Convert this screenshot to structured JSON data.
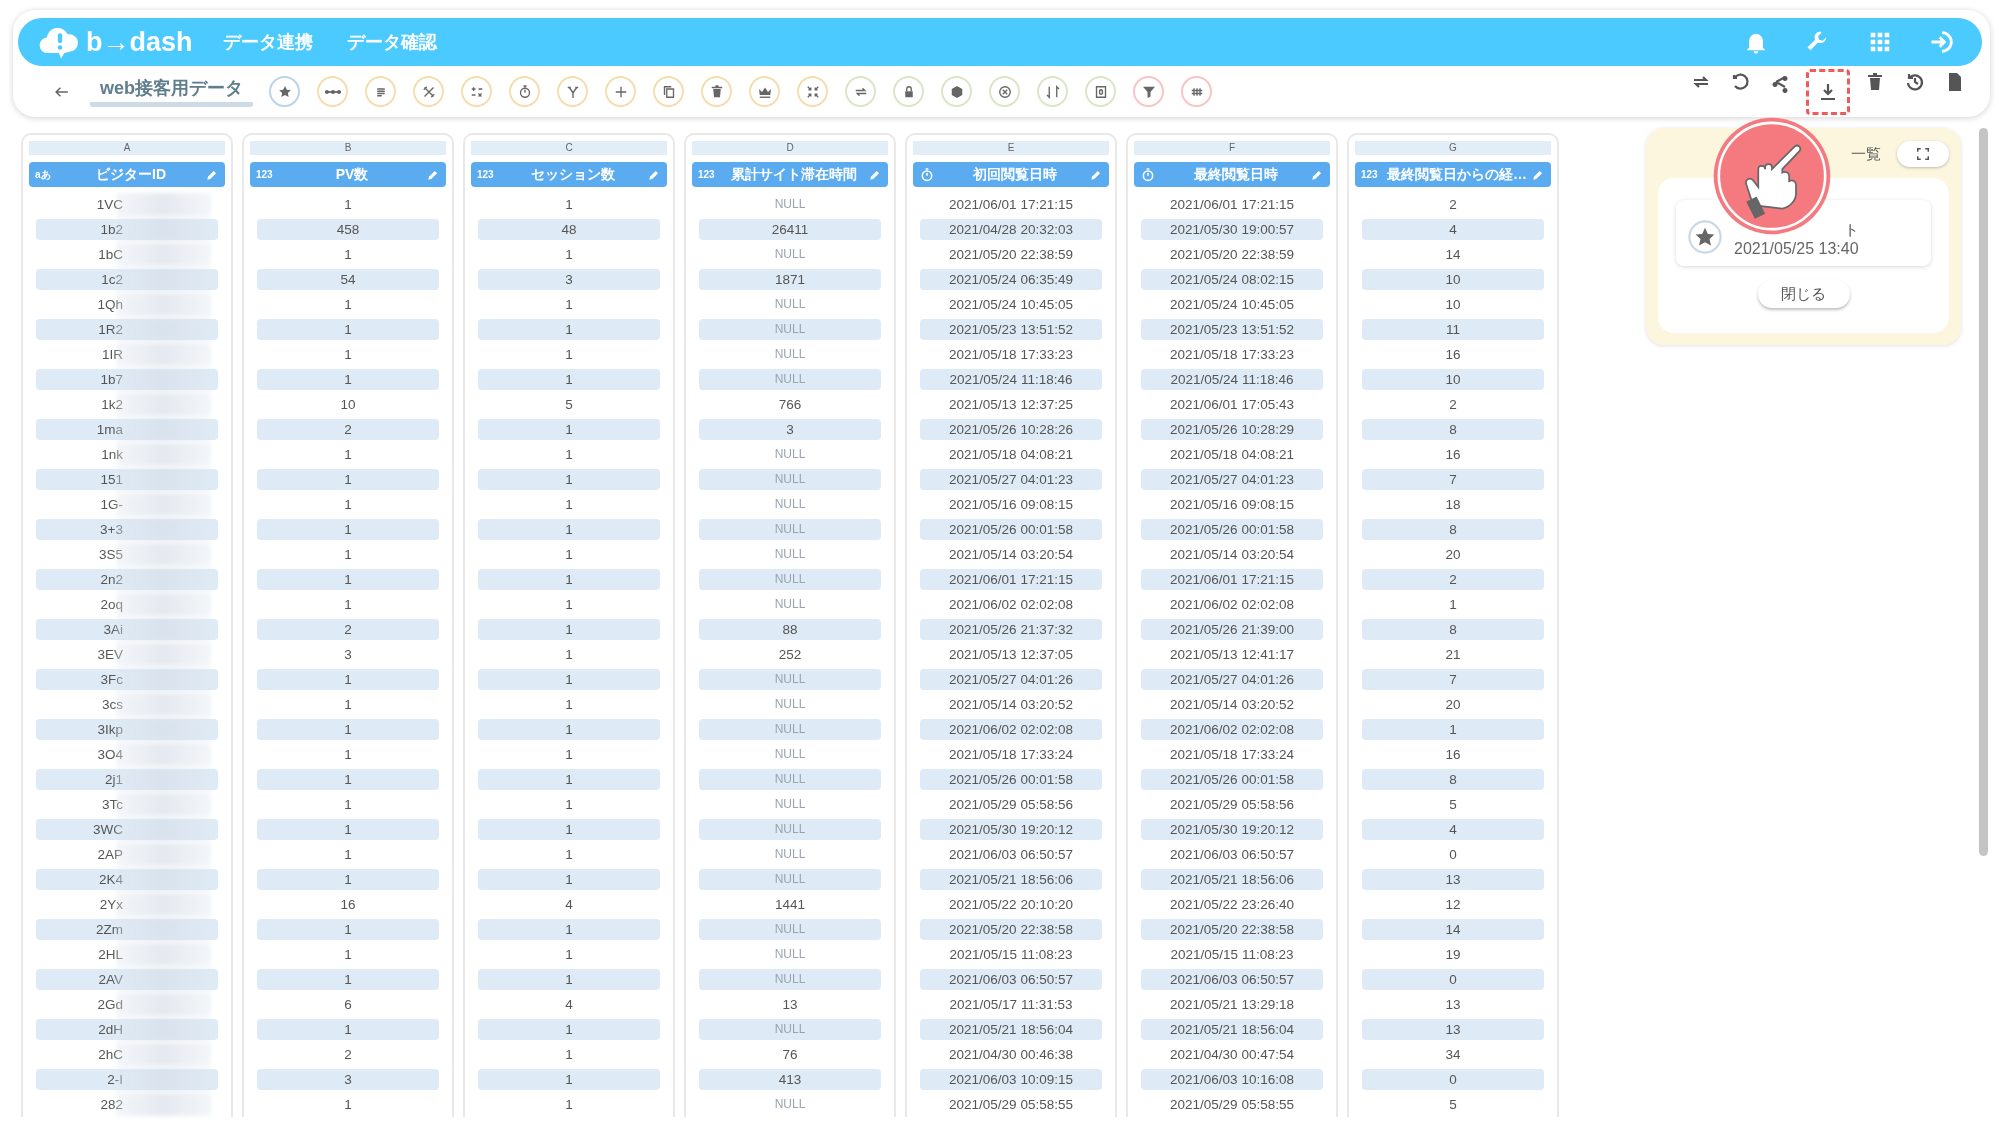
{
  "header": {
    "logo": "b→dash",
    "nav": [
      {
        "label": "データ連携"
      },
      {
        "label": "データ確認"
      }
    ]
  },
  "toolbar": {
    "title": "web接客用データ",
    "tools": [
      {
        "color": "#bcd3ea"
      },
      {
        "color": "#f3dfae"
      },
      {
        "color": "#f3dfae"
      },
      {
        "color": "#f3dfae"
      },
      {
        "color": "#f3dfae"
      },
      {
        "color": "#f3dfae"
      },
      {
        "color": "#f3dfae"
      },
      {
        "color": "#f3dfae"
      },
      {
        "color": "#f3dfae"
      },
      {
        "color": "#f3dfae"
      },
      {
        "color": "#f3dfae"
      },
      {
        "color": "#f3dfae"
      },
      {
        "color": "#dbe5c8"
      },
      {
        "color": "#dbe5c8"
      },
      {
        "color": "#dbe5c8"
      },
      {
        "color": "#dbe5c8"
      },
      {
        "color": "#dbe5c8"
      },
      {
        "color": "#dbe5c8"
      },
      {
        "color": "#f6c6c6"
      },
      {
        "color": "#f6c6c6"
      }
    ],
    "actions": [
      {
        "highlighted": false
      },
      {
        "highlighted": false
      },
      {
        "highlighted": false
      },
      {
        "highlighted": true
      },
      {
        "highlighted": false
      },
      {
        "highlighted": false
      },
      {
        "highlighted": false
      }
    ]
  },
  "columns": [
    {
      "letter": "A",
      "name": "ビジターID",
      "kind": "text",
      "badge": "aあ"
    },
    {
      "letter": "B",
      "name": "PV数",
      "kind": "number",
      "badge": "123"
    },
    {
      "letter": "C",
      "name": "セッション数",
      "kind": "number",
      "badge": "123"
    },
    {
      "letter": "D",
      "name": "累計サイト滞在時間",
      "kind": "number",
      "badge": "123"
    },
    {
      "letter": "E",
      "name": "初回閲覧日時",
      "kind": "datetime"
    },
    {
      "letter": "F",
      "name": "最終閲覧日時",
      "kind": "datetime"
    },
    {
      "letter": "G",
      "name": "最終閲覧日からの経…",
      "kind": "number",
      "badge": "123"
    }
  ],
  "rows": [
    {
      "cells": [
        "1VC",
        "1",
        "1",
        "NULL",
        "2021/06/01 17:21:15",
        "2021/06/01 17:21:15",
        "2"
      ],
      "d_null": true
    },
    {
      "cells": [
        "1b2",
        "458",
        "48",
        "26411",
        "2021/04/28 20:32:03",
        "2021/05/30 19:00:57",
        "4"
      ],
      "d_null": false
    },
    {
      "cells": [
        "1bC",
        "1",
        "1",
        "NULL",
        "2021/05/20 22:38:59",
        "2021/05/20 22:38:59",
        "14"
      ],
      "d_null": true
    },
    {
      "cells": [
        "1c2",
        "54",
        "3",
        "1871",
        "2021/05/24 06:35:49",
        "2021/05/24 08:02:15",
        "10"
      ],
      "d_null": false
    },
    {
      "cells": [
        "1Qh",
        "1",
        "1",
        "NULL",
        "2021/05/24 10:45:05",
        "2021/05/24 10:45:05",
        "10"
      ],
      "d_null": true
    },
    {
      "cells": [
        "1R2",
        "1",
        "1",
        "NULL",
        "2021/05/23 13:51:52",
        "2021/05/23 13:51:52",
        "11"
      ],
      "d_null": true
    },
    {
      "cells": [
        "1IR",
        "1",
        "1",
        "NULL",
        "2021/05/18 17:33:23",
        "2021/05/18 17:33:23",
        "16"
      ],
      "d_null": true
    },
    {
      "cells": [
        "1b7",
        "1",
        "1",
        "NULL",
        "2021/05/24 11:18:46",
        "2021/05/24 11:18:46",
        "10"
      ],
      "d_null": true
    },
    {
      "cells": [
        "1k2",
        "10",
        "5",
        "766",
        "2021/05/13 12:37:25",
        "2021/06/01 17:05:43",
        "2"
      ],
      "d_null": false
    },
    {
      "cells": [
        "1ma",
        "2",
        "1",
        "3",
        "2021/05/26 10:28:26",
        "2021/05/26 10:28:29",
        "8"
      ],
      "d_null": false
    },
    {
      "cells": [
        "1nk",
        "1",
        "1",
        "NULL",
        "2021/05/18 04:08:21",
        "2021/05/18 04:08:21",
        "16"
      ],
      "d_null": true
    },
    {
      "cells": [
        "151",
        "1",
        "1",
        "NULL",
        "2021/05/27 04:01:23",
        "2021/05/27 04:01:23",
        "7"
      ],
      "d_null": true
    },
    {
      "cells": [
        "1G-",
        "1",
        "1",
        "NULL",
        "2021/05/16 09:08:15",
        "2021/05/16 09:08:15",
        "18"
      ],
      "d_null": true
    },
    {
      "cells": [
        "3+3",
        "1",
        "1",
        "NULL",
        "2021/05/26 00:01:58",
        "2021/05/26 00:01:58",
        "8"
      ],
      "d_null": true
    },
    {
      "cells": [
        "3S5",
        "1",
        "1",
        "NULL",
        "2021/05/14 03:20:54",
        "2021/05/14 03:20:54",
        "20"
      ],
      "d_null": true
    },
    {
      "cells": [
        "2n2",
        "1",
        "1",
        "NULL",
        "2021/06/01 17:21:15",
        "2021/06/01 17:21:15",
        "2"
      ],
      "d_null": true
    },
    {
      "cells": [
        "2oq",
        "1",
        "1",
        "NULL",
        "2021/06/02 02:02:08",
        "2021/06/02 02:02:08",
        "1"
      ],
      "d_null": true
    },
    {
      "cells": [
        "3Ai",
        "2",
        "1",
        "88",
        "2021/05/26 21:37:32",
        "2021/05/26 21:39:00",
        "8"
      ],
      "d_null": false
    },
    {
      "cells": [
        "3EV",
        "3",
        "1",
        "252",
        "2021/05/13 12:37:05",
        "2021/05/13 12:41:17",
        "21"
      ],
      "d_null": false
    },
    {
      "cells": [
        "3Fc",
        "1",
        "1",
        "NULL",
        "2021/05/27 04:01:26",
        "2021/05/27 04:01:26",
        "7"
      ],
      "d_null": true
    },
    {
      "cells": [
        "3cs",
        "1",
        "1",
        "NULL",
        "2021/05/14 03:20:52",
        "2021/05/14 03:20:52",
        "20"
      ],
      "d_null": true
    },
    {
      "cells": [
        "3Ikp",
        "1",
        "1",
        "NULL",
        "2021/06/02 02:02:08",
        "2021/06/02 02:02:08",
        "1"
      ],
      "d_null": true
    },
    {
      "cells": [
        "3O4",
        "1",
        "1",
        "NULL",
        "2021/05/18 17:33:24",
        "2021/05/18 17:33:24",
        "16"
      ],
      "d_null": true
    },
    {
      "cells": [
        "2j1",
        "1",
        "1",
        "NULL",
        "2021/05/26 00:01:58",
        "2021/05/26 00:01:58",
        "8"
      ],
      "d_null": true
    },
    {
      "cells": [
        "3Tc",
        "1",
        "1",
        "NULL",
        "2021/05/29 05:58:56",
        "2021/05/29 05:58:56",
        "5"
      ],
      "d_null": true
    },
    {
      "cells": [
        "3WC",
        "1",
        "1",
        "NULL",
        "2021/05/30 19:20:12",
        "2021/05/30 19:20:12",
        "4"
      ],
      "d_null": true
    },
    {
      "cells": [
        "2AP",
        "1",
        "1",
        "NULL",
        "2021/06/03 06:50:57",
        "2021/06/03 06:50:57",
        "0"
      ],
      "d_null": true
    },
    {
      "cells": [
        "2K4",
        "1",
        "1",
        "NULL",
        "2021/05/21 18:56:06",
        "2021/05/21 18:56:06",
        "13"
      ],
      "d_null": true
    },
    {
      "cells": [
        "2Yx",
        "16",
        "4",
        "1441",
        "2021/05/22 20:10:20",
        "2021/05/22 23:26:40",
        "12"
      ],
      "d_null": false
    },
    {
      "cells": [
        "2Zm",
        "1",
        "1",
        "NULL",
        "2021/05/20 22:38:58",
        "2021/05/20 22:38:58",
        "14"
      ],
      "d_null": true
    },
    {
      "cells": [
        "2HL",
        "1",
        "1",
        "NULL",
        "2021/05/15 11:08:23",
        "2021/05/15 11:08:23",
        "19"
      ],
      "d_null": true
    },
    {
      "cells": [
        "2AV",
        "1",
        "1",
        "NULL",
        "2021/06/03 06:50:57",
        "2021/06/03 06:50:57",
        "0"
      ],
      "d_null": true
    },
    {
      "cells": [
        "2Gd",
        "6",
        "4",
        "13",
        "2021/05/17 11:31:53",
        "2021/05/21 13:29:18",
        "13"
      ],
      "d_null": false
    },
    {
      "cells": [
        "2dH",
        "1",
        "1",
        "NULL",
        "2021/05/21 18:56:04",
        "2021/05/21 18:56:04",
        "13"
      ],
      "d_null": true
    },
    {
      "cells": [
        "2hC",
        "2",
        "1",
        "76",
        "2021/04/30 00:46:38",
        "2021/04/30 00:47:54",
        "34"
      ],
      "d_null": false
    },
    {
      "cells": [
        "2-I",
        "3",
        "1",
        "413",
        "2021/06/03 10:09:15",
        "2021/06/03 10:16:08",
        "0"
      ],
      "d_null": false
    },
    {
      "cells": [
        "282",
        "1",
        "1",
        "NULL",
        "2021/05/29 05:58:55",
        "2021/05/29 05:58:55",
        "5"
      ],
      "d_null": true
    }
  ],
  "popup": {
    "title": "一覧",
    "items": [
      {
        "name": "ト",
        "date": "2021/05/25 13:40"
      }
    ],
    "close": "閉じる"
  }
}
